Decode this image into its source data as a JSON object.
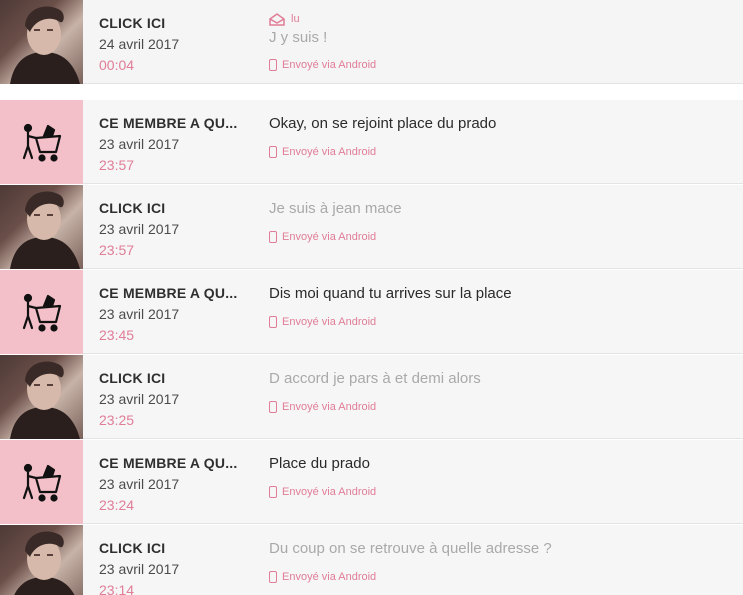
{
  "colors": {
    "accent": "#e07d97",
    "avatar_pink": "#f3bfc8",
    "row_bg": "#f6f6f6"
  },
  "messages": [
    {
      "author": "CLICK ICI",
      "date": "24 avril 2017",
      "time": "00:04",
      "status_label": "lu",
      "status_icon": "envelope-open-icon",
      "text": "J y suis !",
      "via": "Envoyé via Android",
      "avatar": "user-photo",
      "read": true
    },
    {
      "author": "CE MEMBRE A QU...",
      "date": "23 avril 2017",
      "time": "23:57",
      "text": "Okay, on se rejoint place du prado",
      "via": "Envoyé via Android",
      "avatar": "deleted-member-icon",
      "read": false
    },
    {
      "author": "CLICK ICI",
      "date": "23 avril 2017",
      "time": "23:57",
      "text": "Je suis à jean mace",
      "via": "Envoyé via Android",
      "avatar": "user-photo",
      "read": true
    },
    {
      "author": "CE MEMBRE A QU...",
      "date": "23 avril 2017",
      "time": "23:45",
      "text": "Dis moi quand tu arrives sur la place",
      "via": "Envoyé via Android",
      "avatar": "deleted-member-icon",
      "read": false
    },
    {
      "author": "CLICK ICI",
      "date": "23 avril 2017",
      "time": "23:25",
      "text": "D accord je pars à et demi alors",
      "via": "Envoyé via Android",
      "avatar": "user-photo",
      "read": true
    },
    {
      "author": "CE MEMBRE A QU...",
      "date": "23 avril 2017",
      "time": "23:24",
      "text": "Place du prado",
      "via": "Envoyé via Android",
      "avatar": "deleted-member-icon",
      "read": false
    },
    {
      "author": "CLICK ICI",
      "date": "23 avril 2017",
      "time": "23:14",
      "text": "Du coup on se retrouve à quelle adresse ?",
      "via": "Envoyé via Android",
      "avatar": "user-photo",
      "read": true
    }
  ]
}
